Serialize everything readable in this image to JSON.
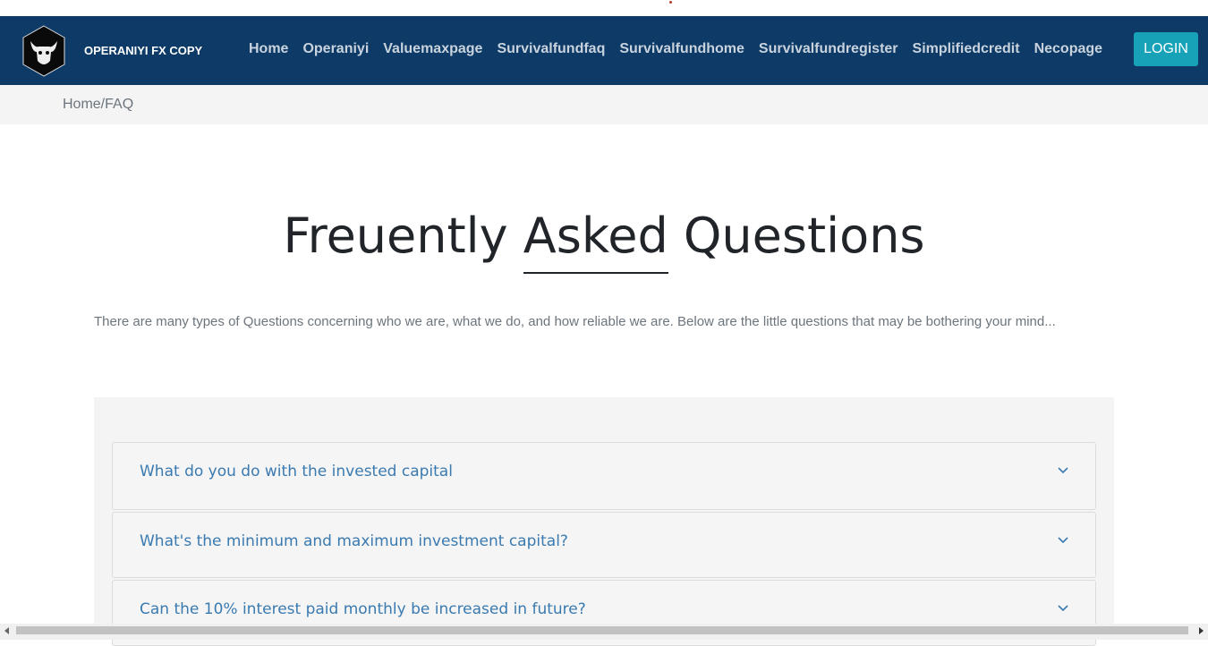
{
  "brand": {
    "name": "OPERANIYI FX COPY",
    "logo_icon": "bull-skull-icon"
  },
  "nav": {
    "links": [
      "Home",
      "Operaniyi",
      "Valuemaxpage",
      "Survivalfundfaq",
      "Survivalfundhome",
      "Survivalfundregister",
      "Simplifiedcredit",
      "Necopage"
    ],
    "login_label": "LOGIN"
  },
  "breadcrumb": "Home/FAQ",
  "title": {
    "word1": "Freuently",
    "word2": "Asked",
    "word3": "Questions"
  },
  "intro": "There are many types of Questions concerning who we are, what we do, and how reliable we are. Below are the little questions that may be bothering your mind...",
  "faq": [
    {
      "question": "What do you do with the invested capital",
      "icon": "chevron-down-icon"
    },
    {
      "question": "What's the minimum and maximum investment capital?",
      "icon": "chevron-down-icon"
    },
    {
      "question": "Can the 10% interest paid monthly be increased in future?",
      "icon": "chevron-down-icon"
    }
  ],
  "colors": {
    "navbar": "#0d3a66",
    "login": "#17a2b8",
    "faq_text": "#3a7ab0"
  }
}
